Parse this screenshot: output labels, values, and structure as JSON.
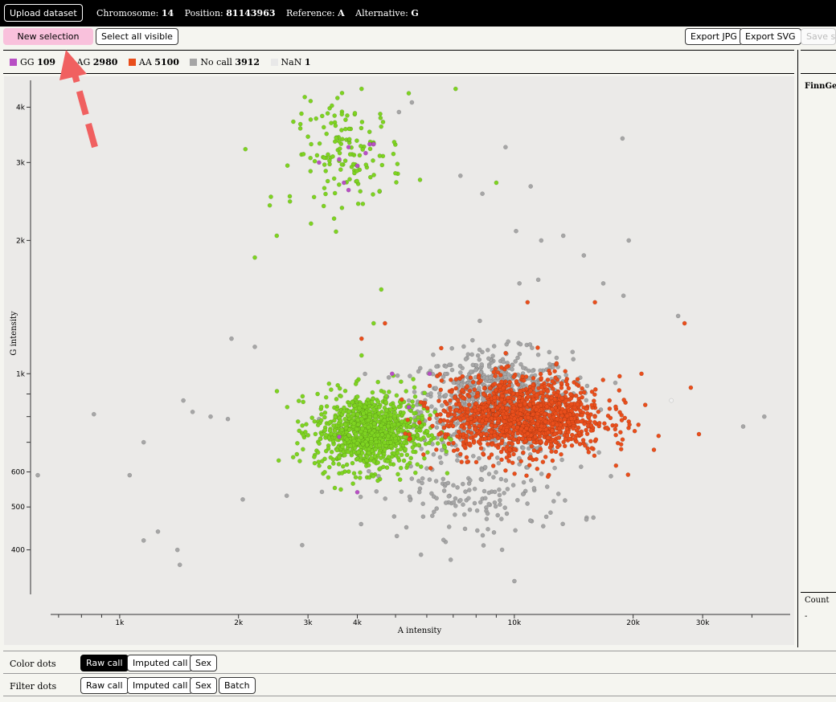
{
  "header": {
    "upload_label": "Upload dataset",
    "chromosome_label": "Chromosome:",
    "chromosome": "14",
    "position_label": "Position:",
    "position": "81143963",
    "reference_label": "Reference:",
    "reference": "A",
    "alternative_label": "Alternative:",
    "alternative": "G"
  },
  "toolbar": {
    "new_selection": "New selection",
    "select_all": "Select all visible",
    "export_jpg": "Export JPG",
    "export_svg": "Export SVG",
    "save_selection": "Save se"
  },
  "legend": [
    {
      "label": "GG",
      "count": "109",
      "color": "#b84fc4"
    },
    {
      "label": "AG",
      "count": "2980",
      "color": "#7ed321"
    },
    {
      "label": "AA",
      "count": "5100",
      "color": "#e94e1b"
    },
    {
      "label": "No call",
      "count": "3912",
      "color": "#a6a6a6"
    },
    {
      "label": "NaN",
      "count": "1",
      "color": "#e8e8e8"
    }
  ],
  "side": {
    "title": "FinnGe",
    "count_label": "Count",
    "count_value": "-"
  },
  "chart_data": {
    "type": "scatter",
    "xlabel": "A intensity",
    "ylabel": "G intensity",
    "xscale": "log",
    "yscale": "log",
    "xlim": [
      600,
      50000
    ],
    "ylim": [
      320,
      4600
    ],
    "xticks": [
      "1k",
      "2k",
      "3k",
      "4k",
      "10k",
      "20k",
      "30k"
    ],
    "yticks": [
      "400",
      "500",
      "600",
      "1k",
      "2k",
      "3k",
      "4k"
    ],
    "grid": false,
    "legend_position": "top",
    "series": [
      {
        "name": "GG",
        "color": "#b84fc4",
        "points": [
          [
            3200,
            3000
          ],
          [
            3600,
            3050
          ],
          [
            3800,
            2600
          ],
          [
            4200,
            3150
          ],
          [
            4400,
            3300
          ],
          [
            3700,
            2700
          ],
          [
            6100,
            1000
          ],
          [
            3600,
            720
          ],
          [
            4000,
            540
          ],
          [
            5400,
            840
          ],
          [
            4900,
            1000
          ],
          [
            4300,
            3300
          ],
          [
            3800,
            3250
          ],
          [
            4000,
            2950
          ]
        ]
      },
      {
        "name": "AG",
        "color": "#7ed321",
        "clusters": [
          {
            "cx": 3800,
            "cy": 3150,
            "sx": 0.16,
            "sy": 0.13,
            "n": 140
          },
          {
            "cx": 4300,
            "cy": 740,
            "sx": 0.16,
            "sy": 0.1,
            "n": 950
          }
        ],
        "points": [
          [
            4100,
            4400
          ],
          [
            7100,
            4400
          ],
          [
            5400,
            4300
          ],
          [
            2400,
            2400
          ],
          [
            2700,
            2450
          ],
          [
            2500,
            2050
          ],
          [
            2200,
            1830
          ],
          [
            9000,
            2700
          ],
          [
            4600,
            1550
          ],
          [
            4400,
            1300
          ],
          [
            4100,
            1100
          ]
        ]
      },
      {
        "name": "AA",
        "color": "#e94e1b",
        "clusters": [
          {
            "cx": 10500,
            "cy": 800,
            "sx": 0.24,
            "sy": 0.1,
            "n": 1300
          }
        ],
        "points": [
          [
            27000,
            1300
          ],
          [
            28000,
            930
          ],
          [
            16000,
            1450
          ],
          [
            10800,
            1450
          ],
          [
            4700,
            1300
          ],
          [
            4100,
            1200
          ],
          [
            21000,
            1000
          ]
        ]
      },
      {
        "name": "No call",
        "color": "#a6a6a6",
        "clusters": [
          {
            "cx": 9000,
            "cy": 860,
            "sx": 0.22,
            "sy": 0.13,
            "n": 850
          },
          {
            "cx": 8000,
            "cy": 520,
            "sx": 0.3,
            "sy": 0.1,
            "n": 140
          }
        ],
        "points": [
          [
            620,
            590
          ],
          [
            860,
            810
          ],
          [
            1060,
            590
          ],
          [
            1150,
            700
          ],
          [
            1150,
            420
          ],
          [
            1250,
            440
          ],
          [
            1400,
            400
          ],
          [
            1420,
            370
          ],
          [
            1450,
            870
          ],
          [
            1530,
            820
          ],
          [
            1700,
            800
          ],
          [
            1880,
            790
          ],
          [
            1920,
            1200
          ],
          [
            2050,
            520
          ],
          [
            2200,
            1150
          ],
          [
            2650,
            530
          ],
          [
            2900,
            410
          ],
          [
            3200,
            790
          ],
          [
            5500,
            4100
          ],
          [
            5100,
            3900
          ],
          [
            7300,
            2800
          ],
          [
            9500,
            3250
          ],
          [
            11000,
            2650
          ],
          [
            8300,
            2550
          ],
          [
            10100,
            2100
          ],
          [
            13300,
            2050
          ],
          [
            15000,
            1850
          ],
          [
            18800,
            3400
          ],
          [
            19500,
            2000
          ],
          [
            10300,
            1600
          ],
          [
            11500,
            1630
          ],
          [
            16800,
            1600
          ],
          [
            18900,
            1500
          ],
          [
            26000,
            1350
          ],
          [
            38000,
            760
          ],
          [
            43000,
            800
          ],
          [
            11700,
            2000
          ],
          [
            10000,
            340
          ],
          [
            6900,
            380
          ],
          [
            5800,
            390
          ]
        ]
      },
      {
        "name": "NaN",
        "color": "#f0f0f0",
        "points": [
          [
            25000,
            870
          ]
        ]
      }
    ]
  }
}
